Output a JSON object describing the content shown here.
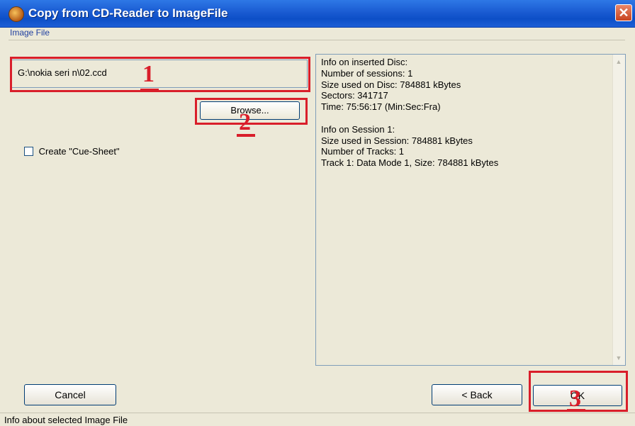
{
  "window": {
    "title": "Copy from CD-Reader to ImageFile",
    "close_glyph": "✕"
  },
  "group": {
    "label": "Image File"
  },
  "path_input": {
    "value": "G:\\nokia seri n\\02.ccd"
  },
  "browse_button": {
    "label": "Browse..."
  },
  "cue_sheet": {
    "label": "Create \"Cue-Sheet\"",
    "checked": false
  },
  "info_lines": [
    "Info on inserted Disc:",
    "Number of sessions: 1",
    "Size used on Disc: 784881 kBytes",
    "Sectors: 341717",
    "Time: 75:56:17 (Min:Sec:Fra)",
    "",
    "Info on Session 1:",
    "Size used in Session: 784881 kBytes",
    "Number of Tracks: 1",
    "Track 1: Data Mode 1, Size: 784881 kBytes"
  ],
  "buttons": {
    "cancel": "Cancel",
    "back": "< Back",
    "ok": "OK"
  },
  "status": {
    "text": "Info about selected Image File"
  },
  "annotations": {
    "one": "1",
    "two": "2",
    "three": "3",
    "color": "#d91e2a"
  },
  "icons": {
    "app": "cd-burner-icon",
    "close": "close-icon",
    "scroll_up": "scroll-up-icon",
    "scroll_down": "scroll-down-icon"
  }
}
